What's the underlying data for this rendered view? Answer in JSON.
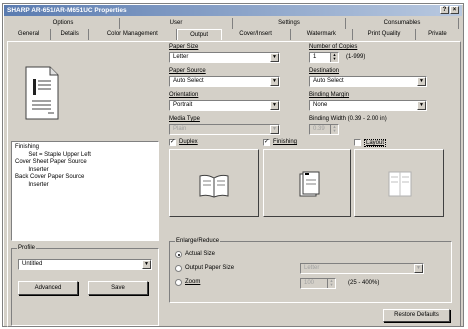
{
  "window": {
    "title": "SHARP AR-651/AR-M651UC Properties"
  },
  "tabs": {
    "top": [
      "Options",
      "User",
      "Settings",
      "Consumables"
    ],
    "bottom": [
      "General",
      "Details",
      "Color Management",
      "Output",
      "Cover/Insert",
      "Watermark",
      "Print Quality",
      "Private"
    ]
  },
  "paper_size": {
    "label": "Paper Size",
    "value": "Letter"
  },
  "copies": {
    "label": "Number of Copies",
    "value": "1",
    "range": "(1-999)"
  },
  "paper_source": {
    "label": "Paper Source",
    "value": "Auto Select"
  },
  "destination": {
    "label": "Destination",
    "value": "Auto Select"
  },
  "orientation": {
    "label": "Orientation",
    "value": "Portrait"
  },
  "binding_margin": {
    "label": "Binding Margin",
    "value": "None"
  },
  "media_type": {
    "label": "Media Type",
    "value": "Plain"
  },
  "binding_width": {
    "label": "Binding Width (0.39 - 2.00 in)",
    "value": "0.39"
  },
  "options": {
    "duplex": "Duplex",
    "finishing": "Finishing",
    "layout": "Layout"
  },
  "summary": {
    "text": "Finishing\n        Set = Staple Upper Left\nCover Sheet Paper Source\n        Inserter\nBack Cover Paper Source\n        Inserter"
  },
  "profile": {
    "label": "Profile",
    "value": "Untitled",
    "advanced": "Advanced",
    "save": "Save"
  },
  "enlarge": {
    "label": "Enlarge/Reduce",
    "actual": "Actual Size",
    "output": "Output Paper Size",
    "zoom": "Zoom",
    "output_value": "Letter",
    "zoom_value": "100",
    "zoom_range": "(25 - 400%)"
  },
  "restore": "Restore Defaults"
}
